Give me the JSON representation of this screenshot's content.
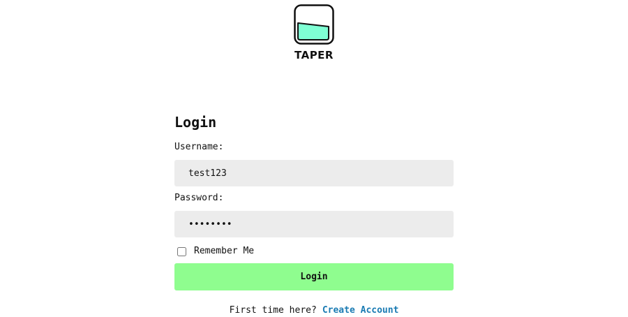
{
  "brand": {
    "name": "TAPER",
    "logo_icon": "tapered-cup-icon",
    "logo_fill_color": "#7fffd4",
    "logo_stroke_color": "#111111"
  },
  "login_form": {
    "title": "Login",
    "username": {
      "label": "Username:",
      "value": "test123"
    },
    "password": {
      "label": "Password:",
      "value": "password"
    },
    "remember_me": {
      "label": "Remember Me",
      "checked": false
    },
    "submit_label": "Login",
    "submit_color": "#8ffd8f"
  },
  "signup": {
    "prompt": "First time here?",
    "link_label": "Create Account",
    "link_color": "#1a7bb3"
  }
}
